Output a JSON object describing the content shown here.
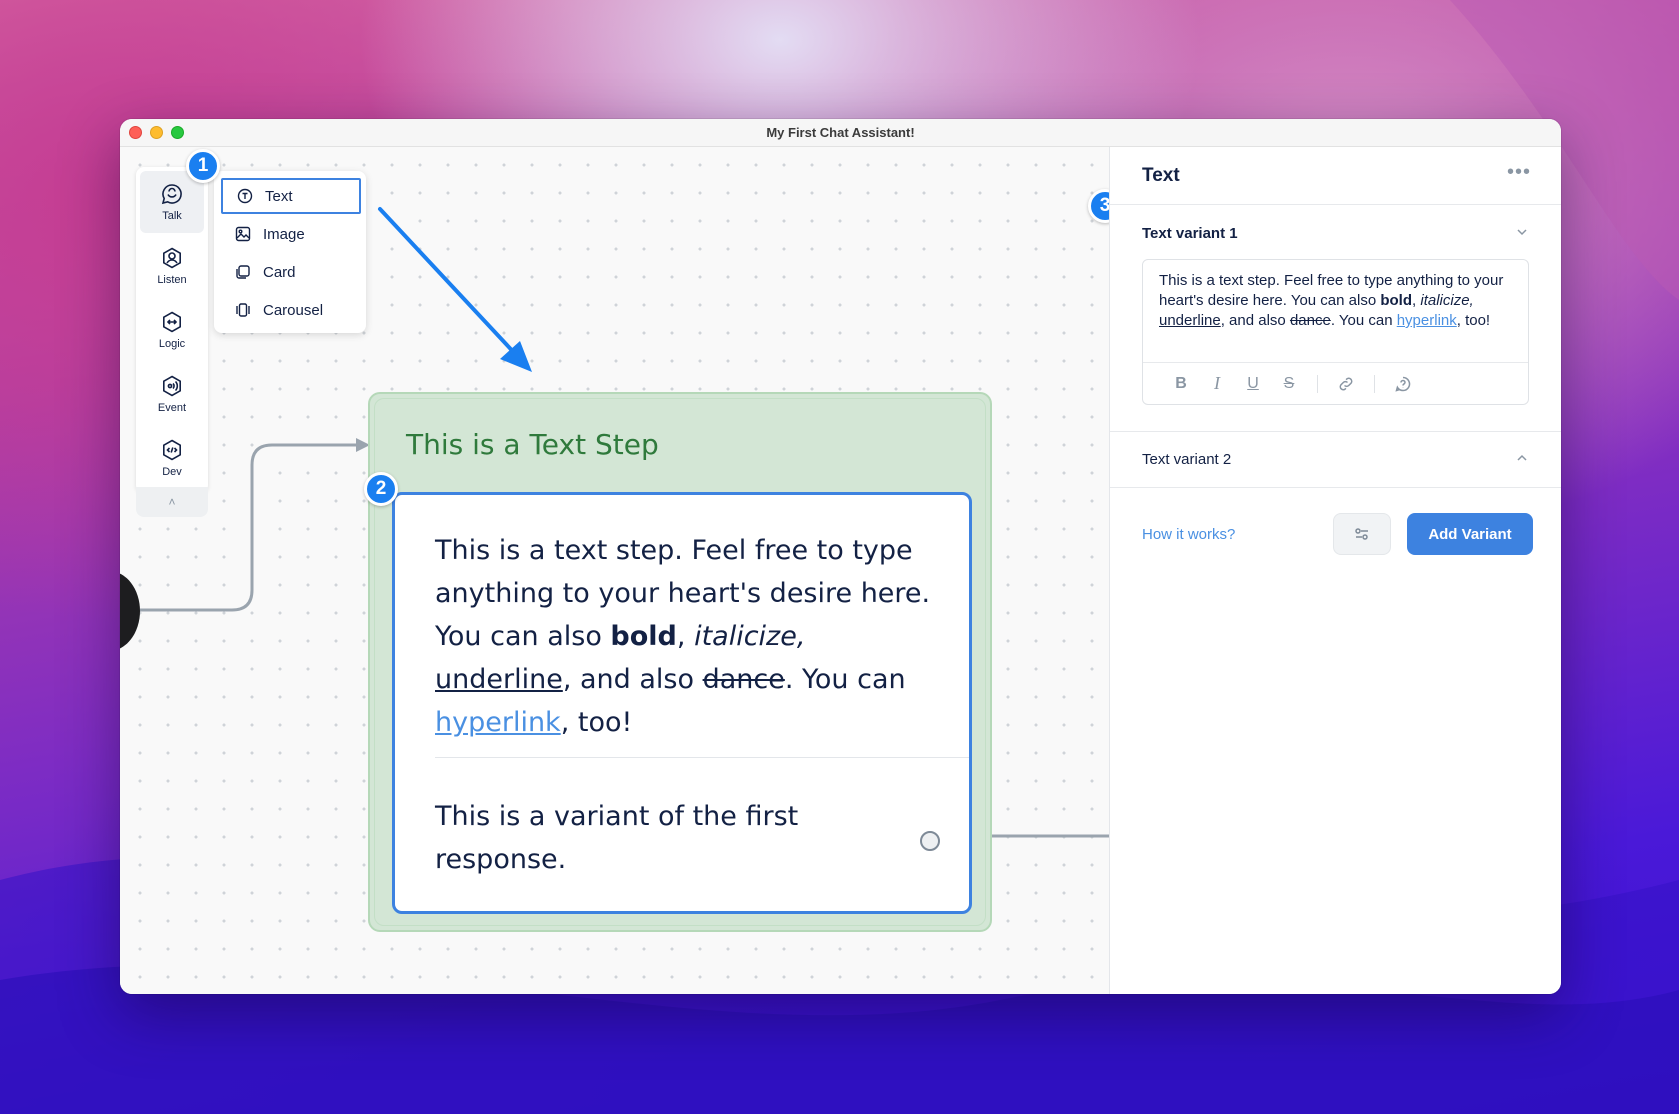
{
  "window": {
    "title": "My First Chat Assistant!"
  },
  "toolbar": {
    "items": [
      {
        "label": "Talk",
        "icon": "chat-bubble-icon",
        "active": true
      },
      {
        "label": "Listen",
        "icon": "user-circle-icon",
        "active": false
      },
      {
        "label": "Logic",
        "icon": "logic-diamond-icon",
        "active": false
      },
      {
        "label": "Event",
        "icon": "broadcast-icon",
        "active": false
      },
      {
        "label": "Dev",
        "icon": "code-icon",
        "active": false
      }
    ],
    "collapse_glyph": "˄"
  },
  "submenu": {
    "items": [
      {
        "label": "Text",
        "icon": "text-circle-icon",
        "selected": true
      },
      {
        "label": "Image",
        "icon": "image-icon",
        "selected": false
      },
      {
        "label": "Card",
        "icon": "card-icon",
        "selected": false
      },
      {
        "label": "Carousel",
        "icon": "carousel-icon",
        "selected": false
      }
    ]
  },
  "badges": {
    "one": "1",
    "two": "2",
    "three": "3"
  },
  "step": {
    "title": "This is a Text Step",
    "text": {
      "p1": "This is a text step. Feel free to type anything to your heart's desire here. You can also ",
      "bold": "bold",
      "p2": ", ",
      "italic": "italicize,",
      "p3": " ",
      "underline": "underline",
      "p4": ", and also ",
      "strike": "dance",
      "p5": ". You can ",
      "link": "hyperlink",
      "p6": ", too!"
    },
    "variant": "This is a variant of the first response."
  },
  "panel": {
    "title": "Text",
    "more": "•••",
    "variant1_label": "Text variant 1",
    "variant2_label": "Text variant 2",
    "editor": {
      "p1": "This is a text step. Feel free to type anything to your heart's desire here. You can also ",
      "bold": "bold",
      "p2": ", ",
      "italic": "italicize,",
      "p3": " ",
      "underline": "underline",
      "p4": ", and also ",
      "strike": "dance",
      "p5": ". You can ",
      "link": "hyperlink",
      "p6": ", too!"
    },
    "format_buttons": {
      "bold": "B",
      "italic": "I",
      "underline": "U",
      "strike": "S"
    },
    "how_it_works": "How it works?",
    "add_variant": "Add Variant"
  },
  "colors": {
    "accent": "#3d82e0",
    "badge": "#1a7ff0",
    "step_green_bg": "#d3e6d5",
    "step_green_text": "#2f7a3c",
    "text_dark": "#132144",
    "link": "#4a90e2"
  }
}
